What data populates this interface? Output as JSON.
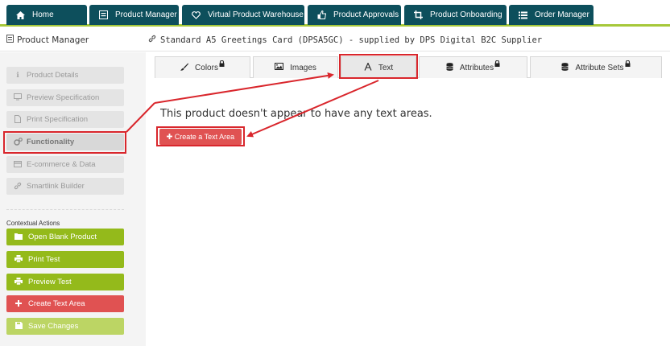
{
  "topnav": {
    "tabs": [
      {
        "label": "Home",
        "icon": "home-icon"
      },
      {
        "label": "Product Manager",
        "icon": "product-manager-icon"
      },
      {
        "label": "Virtual Product Warehouse",
        "icon": "heart-icon"
      },
      {
        "label": "Product Approvals",
        "icon": "thumbs-up-icon"
      },
      {
        "label": "Product Onboarding",
        "icon": "crop-icon"
      },
      {
        "label": "Order Manager",
        "icon": "list-icon"
      }
    ],
    "color": "#0d4f5c",
    "accent": "#a6c83a"
  },
  "header": {
    "section_title": "Product Manager",
    "breadcrumb": "Standard A5 Greetings Card (DPSA5GC) - supplied by DPS Digital B2C Supplier"
  },
  "sidebar": {
    "items": [
      {
        "label": "Product Details",
        "icon": "info-icon"
      },
      {
        "label": "Preview Specification",
        "icon": "monitor-icon"
      },
      {
        "label": "Print Specification",
        "icon": "file-icon"
      },
      {
        "label": "Functionality",
        "icon": "cogs-icon",
        "active": true
      },
      {
        "label": "E-commerce & Data",
        "icon": "credit-card-icon"
      },
      {
        "label": "Smartlink Builder",
        "icon": "link-icon"
      }
    ],
    "contextual_actions_label": "Contextual Actions",
    "actions": [
      {
        "label": "Open Blank Product",
        "icon": "folder-icon",
        "color": "#94ba1b"
      },
      {
        "label": "Print Test",
        "icon": "print-icon",
        "color": "#94ba1b"
      },
      {
        "label": "Preview Test",
        "icon": "print-icon",
        "color": "#94ba1b"
      },
      {
        "label": "Create Text Area",
        "icon": "plus-icon",
        "color": "#e05252"
      },
      {
        "label": "Save Changes",
        "icon": "save-icon",
        "color": "#bcd564"
      }
    ]
  },
  "tabs": [
    {
      "label": "Colors",
      "icon": "brush-icon",
      "locked": true
    },
    {
      "label": "Images",
      "icon": "image-icon",
      "locked": false
    },
    {
      "label": "Text",
      "icon": "font-icon",
      "locked": false,
      "active": true
    },
    {
      "label": "Attributes",
      "icon": "database-icon",
      "locked": true
    },
    {
      "label": "Attribute Sets",
      "icon": "database-icon",
      "locked": true
    }
  ],
  "content": {
    "message": "This product doesn't appear to have any text areas.",
    "create_button": "Create a Text Area"
  },
  "annotation_color": "#d9262c"
}
